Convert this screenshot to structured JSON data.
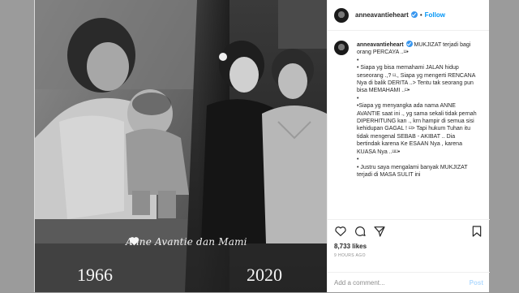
{
  "photo": {
    "caption": "Anne Avantie dan Mami",
    "year_left": "1966",
    "year_right": "2020",
    "heart_icon": "white-heart-icon"
  },
  "header": {
    "username": "anneavantieheart",
    "separator": "•",
    "follow_label": "Follow"
  },
  "caption": {
    "username": "anneavantieheart",
    "lines": [
      "MUKJIZAT terjadi bagi orang PERCAYA ..⌑•",
      "•",
      "• Siapa yg bisa memahami JALAN hidup seseorang .,? ⌑., Siapa yg mengerti RENCANA Nya di balik DERITA ..> Tentu tak seorang pun bisa MEMAHAMI ..⌑•",
      "•",
      "•Siapa yg menyangka ada nama ANNE AVANTIE saat ini ., yg sama sekali tidak pernah DIPERHITUNG kan ., krn hampir di semua sisi kehidupan GAGAL ! ⌑> Tapi hukum Tuhan itu tidak mengenal SEBAB - AKIBAT .. Dia bertindak karena Ke ESAAN Nya , karena KUASA Nya ..⌑⌑•",
      "•",
      "• Justru saya mengalami banyak MUKJIZAT terjadi di MASA SULIT ini"
    ]
  },
  "actions": {
    "likes": "8,733 likes",
    "time": "9 HOURS AGO",
    "comment_placeholder": "Add a comment...",
    "post_label": "Post"
  }
}
